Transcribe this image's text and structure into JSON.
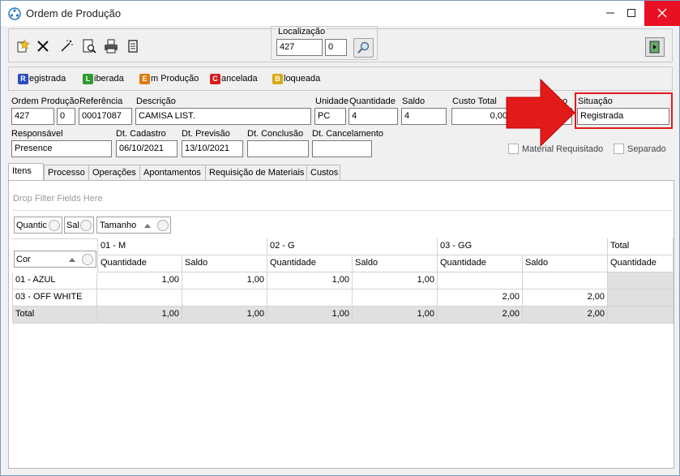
{
  "window": {
    "title": "Ordem de Produção",
    "minimize_icon": "minimize-icon",
    "maximize_icon": "maximize-icon",
    "close_icon": "close-icon"
  },
  "toolbar": {
    "icons": [
      "new-record-icon",
      "delete-icon",
      "wand-icon",
      "preview-icon",
      "print-icon",
      "document-icon"
    ],
    "exit_icon": "exit-icon"
  },
  "localizacao": {
    "label": "Localização",
    "value1": "427",
    "value2": "0",
    "search_icon": "search-icon"
  },
  "statuses": [
    {
      "letter": "R",
      "rest": "egistrada",
      "color": "#2a4fc4"
    },
    {
      "letter": "L",
      "rest": "iberada",
      "color": "#2e9a2e"
    },
    {
      "letter": "E",
      "rest": "m Produção",
      "color": "#e07a10"
    },
    {
      "letter": "C",
      "rest": "ancelada",
      "color": "#d42020"
    },
    {
      "letter": "B",
      "rest": "loqueada",
      "color": "#d8a818"
    }
  ],
  "form": {
    "ordem_producao": {
      "label": "Ordem Produção",
      "value1": "427",
      "value2": "0"
    },
    "referencia": {
      "label": "Referência",
      "value": "00017087"
    },
    "descricao": {
      "label": "Descrição",
      "value": "CAMISA LIST."
    },
    "unidade": {
      "label": "Unidade",
      "value": "PC"
    },
    "quantidade": {
      "label": "Quantidade",
      "value": "4"
    },
    "saldo": {
      "label": "Saldo",
      "value": "4"
    },
    "custo_total": {
      "label": "Custo Total",
      "value": "0,00"
    },
    "hidden_label_fragment": "o",
    "situacao": {
      "label": "Situação",
      "value": "Registrada"
    },
    "responsavel": {
      "label": "Responsável",
      "value": "Presence"
    },
    "dt_cadastro": {
      "label": "Dt. Cadastro",
      "value": "06/10/2021"
    },
    "dt_previsao": {
      "label": "Dt. Previsão",
      "value": "13/10/2021"
    },
    "dt_conclusao": {
      "label": "Dt. Conclusão",
      "value": ""
    },
    "dt_cancelamento": {
      "label": "Dt. Cancelamento",
      "value": ""
    },
    "material_requisitado": {
      "label": "Material Requisitado",
      "checked": false
    },
    "separado": {
      "label": "Separado",
      "checked": false
    }
  },
  "tabs": [
    "Itens",
    "Processo",
    "Operações",
    "Apontamentos",
    "Requisição de Materiais",
    "Custos"
  ],
  "pivot": {
    "drop_filter": "Drop Filter Fields Here",
    "column_fields": [
      "Quantic",
      "Sal",
      "Tamanho"
    ],
    "row_field": "Cor",
    "size_headers": [
      "01 - M",
      "02 - G",
      "03 - GG",
      "Total"
    ],
    "measure_headers": [
      "Quantidade",
      "Saldo",
      "Quantidade",
      "Saldo",
      "Quantidade",
      "Saldo",
      "Quantidade"
    ],
    "rows": [
      {
        "label": "01 - AZUL",
        "values": [
          "1,00",
          "1,00",
          "1,00",
          "1,00",
          "",
          "",
          ""
        ]
      },
      {
        "label": "03 - OFF WHITE",
        "values": [
          "",
          "",
          "",
          "",
          "2,00",
          "2,00",
          ""
        ]
      },
      {
        "label": "Total",
        "values": [
          "1,00",
          "1,00",
          "1,00",
          "1,00",
          "2,00",
          "2,00",
          ""
        ]
      }
    ]
  },
  "highlight": {
    "color": "#e21a1a"
  }
}
